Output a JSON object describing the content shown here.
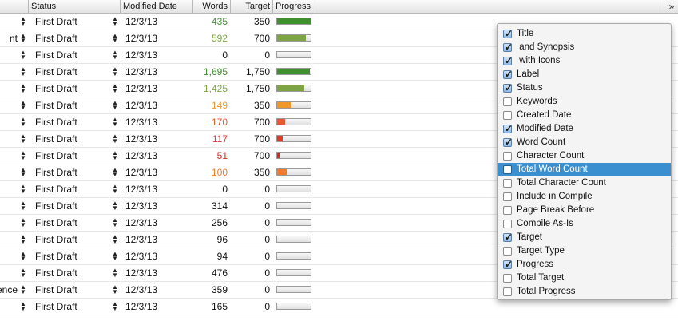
{
  "header": {
    "status": "Status",
    "modified": "Modified Date",
    "words": "Words",
    "target": "Target",
    "progress": "Progress",
    "more": "»"
  },
  "rows": [
    {
      "title": "",
      "status": "First Draft",
      "modified": "12/3/13",
      "words": "435",
      "target": "350",
      "progress": 1.0,
      "color": "#3f8f2e"
    },
    {
      "title": "nt",
      "status": "First Draft",
      "modified": "12/3/13",
      "words": "592",
      "target": "700",
      "progress": 0.846,
      "color": "#7da343"
    },
    {
      "title": "",
      "status": "First Draft",
      "modified": "12/3/13",
      "words": "0",
      "target": "0",
      "progress": 0.0,
      "color": "#111111"
    },
    {
      "title": "",
      "status": "First Draft",
      "modified": "12/3/13",
      "words": "1,695",
      "target": "1,750",
      "progress": 0.969,
      "color": "#3f8f2e"
    },
    {
      "title": "",
      "status": "First Draft",
      "modified": "12/3/13",
      "words": "1,425",
      "target": "1,750",
      "progress": 0.814,
      "color": "#7da343"
    },
    {
      "title": "",
      "status": "First Draft",
      "modified": "12/3/13",
      "words": "149",
      "target": "350",
      "progress": 0.426,
      "color": "#f0962a"
    },
    {
      "title": "",
      "status": "First Draft",
      "modified": "12/3/13",
      "words": "170",
      "target": "700",
      "progress": 0.243,
      "color": "#e8572e"
    },
    {
      "title": "",
      "status": "First Draft",
      "modified": "12/3/13",
      "words": "117",
      "target": "700",
      "progress": 0.167,
      "color": "#e23a2a"
    },
    {
      "title": "",
      "status": "First Draft",
      "modified": "12/3/13",
      "words": "51",
      "target": "700",
      "progress": 0.073,
      "color": "#d9261f"
    },
    {
      "title": "",
      "status": "First Draft",
      "modified": "12/3/13",
      "words": "100",
      "target": "350",
      "progress": 0.286,
      "color": "#f07a2e"
    },
    {
      "title": "",
      "status": "First Draft",
      "modified": "12/3/13",
      "words": "0",
      "target": "0",
      "progress": 0.0,
      "color": "#111111"
    },
    {
      "title": "",
      "status": "First Draft",
      "modified": "12/3/13",
      "words": "314",
      "target": "0",
      "progress": 0.0,
      "color": "#111111"
    },
    {
      "title": "",
      "status": "First Draft",
      "modified": "12/3/13",
      "words": "256",
      "target": "0",
      "progress": 0.0,
      "color": "#111111"
    },
    {
      "title": "",
      "status": "First Draft",
      "modified": "12/3/13",
      "words": "96",
      "target": "0",
      "progress": 0.0,
      "color": "#111111"
    },
    {
      "title": "",
      "status": "First Draft",
      "modified": "12/3/13",
      "words": "94",
      "target": "0",
      "progress": 0.0,
      "color": "#111111"
    },
    {
      "title": "",
      "status": "First Draft",
      "modified": "12/3/13",
      "words": "476",
      "target": "0",
      "progress": 0.0,
      "color": "#111111"
    },
    {
      "title": "ence",
      "status": "First Draft",
      "modified": "12/3/13",
      "words": "359",
      "target": "0",
      "progress": 0.0,
      "color": "#111111"
    },
    {
      "title": "",
      "status": "First Draft",
      "modified": "12/3/13",
      "words": "165",
      "target": "0",
      "progress": 0.0,
      "color": "#111111"
    }
  ],
  "menu": {
    "items": [
      {
        "label": "Title",
        "checked": true
      },
      {
        "label": " and Synopsis",
        "checked": true
      },
      {
        "label": " with Icons",
        "checked": true
      },
      {
        "label": "Label",
        "checked": true
      },
      {
        "label": "Status",
        "checked": true
      },
      {
        "label": "Keywords",
        "checked": false
      },
      {
        "label": "Created Date",
        "checked": false
      },
      {
        "label": "Modified Date",
        "checked": true
      },
      {
        "label": "Word Count",
        "checked": true
      },
      {
        "label": "Character Count",
        "checked": false
      },
      {
        "label": "Total Word Count",
        "checked": false,
        "highlighted": true
      },
      {
        "label": "Total Character Count",
        "checked": false
      },
      {
        "label": "Include in Compile",
        "checked": false
      },
      {
        "label": "Page Break Before",
        "checked": false
      },
      {
        "label": "Compile As-Is",
        "checked": false
      },
      {
        "label": "Target",
        "checked": true
      },
      {
        "label": "Target Type",
        "checked": false
      },
      {
        "label": "Progress",
        "checked": true
      },
      {
        "label": "Total Target",
        "checked": false
      },
      {
        "label": "Total Progress",
        "checked": false
      }
    ]
  },
  "colors": {
    "highlight": "#3a8fd0",
    "green": "#3f8f2e",
    "olive": "#7da343",
    "orange": "#f0962a",
    "red": "#d9261f"
  }
}
